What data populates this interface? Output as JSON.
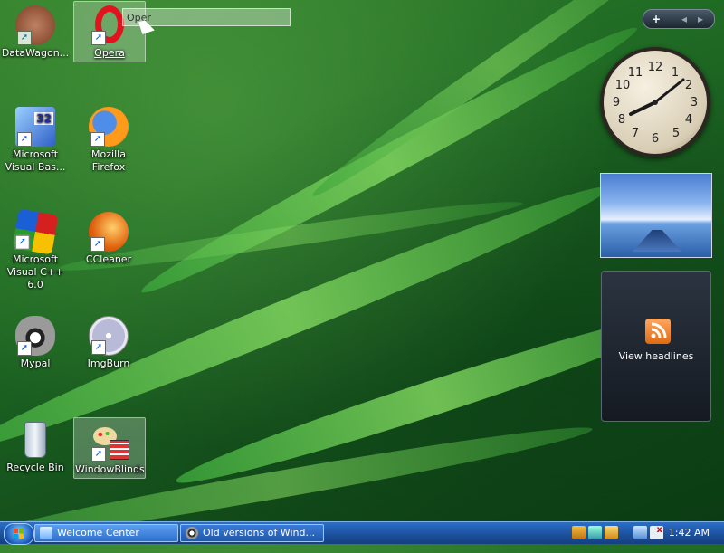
{
  "desktop": {
    "icons": [
      {
        "label": "DataWagon..."
      },
      {
        "label": "Opera"
      },
      {
        "label": "Microsoft Visual Bas..."
      },
      {
        "label": "Mozilla Firefox"
      },
      {
        "label": "Microsoft Visual C++ 6.0"
      },
      {
        "label": "CCleaner"
      },
      {
        "label": "Mypal"
      },
      {
        "label": "ImgBurn"
      },
      {
        "label": "Recycle Bin"
      },
      {
        "label": "WindowBlinds"
      }
    ],
    "rename_text": "Oper"
  },
  "sidebar": {
    "add_label": "+",
    "prev_label": "◂",
    "next_label": "▸",
    "clock_numbers": [
      "12",
      "1",
      "2",
      "3",
      "4",
      "5",
      "6",
      "7",
      "8",
      "9",
      "10",
      "11"
    ],
    "feed_label": "View headlines"
  },
  "taskbar": {
    "tasks": [
      {
        "label": "Welcome Center"
      },
      {
        "label": "Old versions of Wind..."
      }
    ],
    "time": "1:42 AM"
  },
  "colors": {
    "taskbar": "#1b4f9a",
    "rss": "#e06a10"
  }
}
